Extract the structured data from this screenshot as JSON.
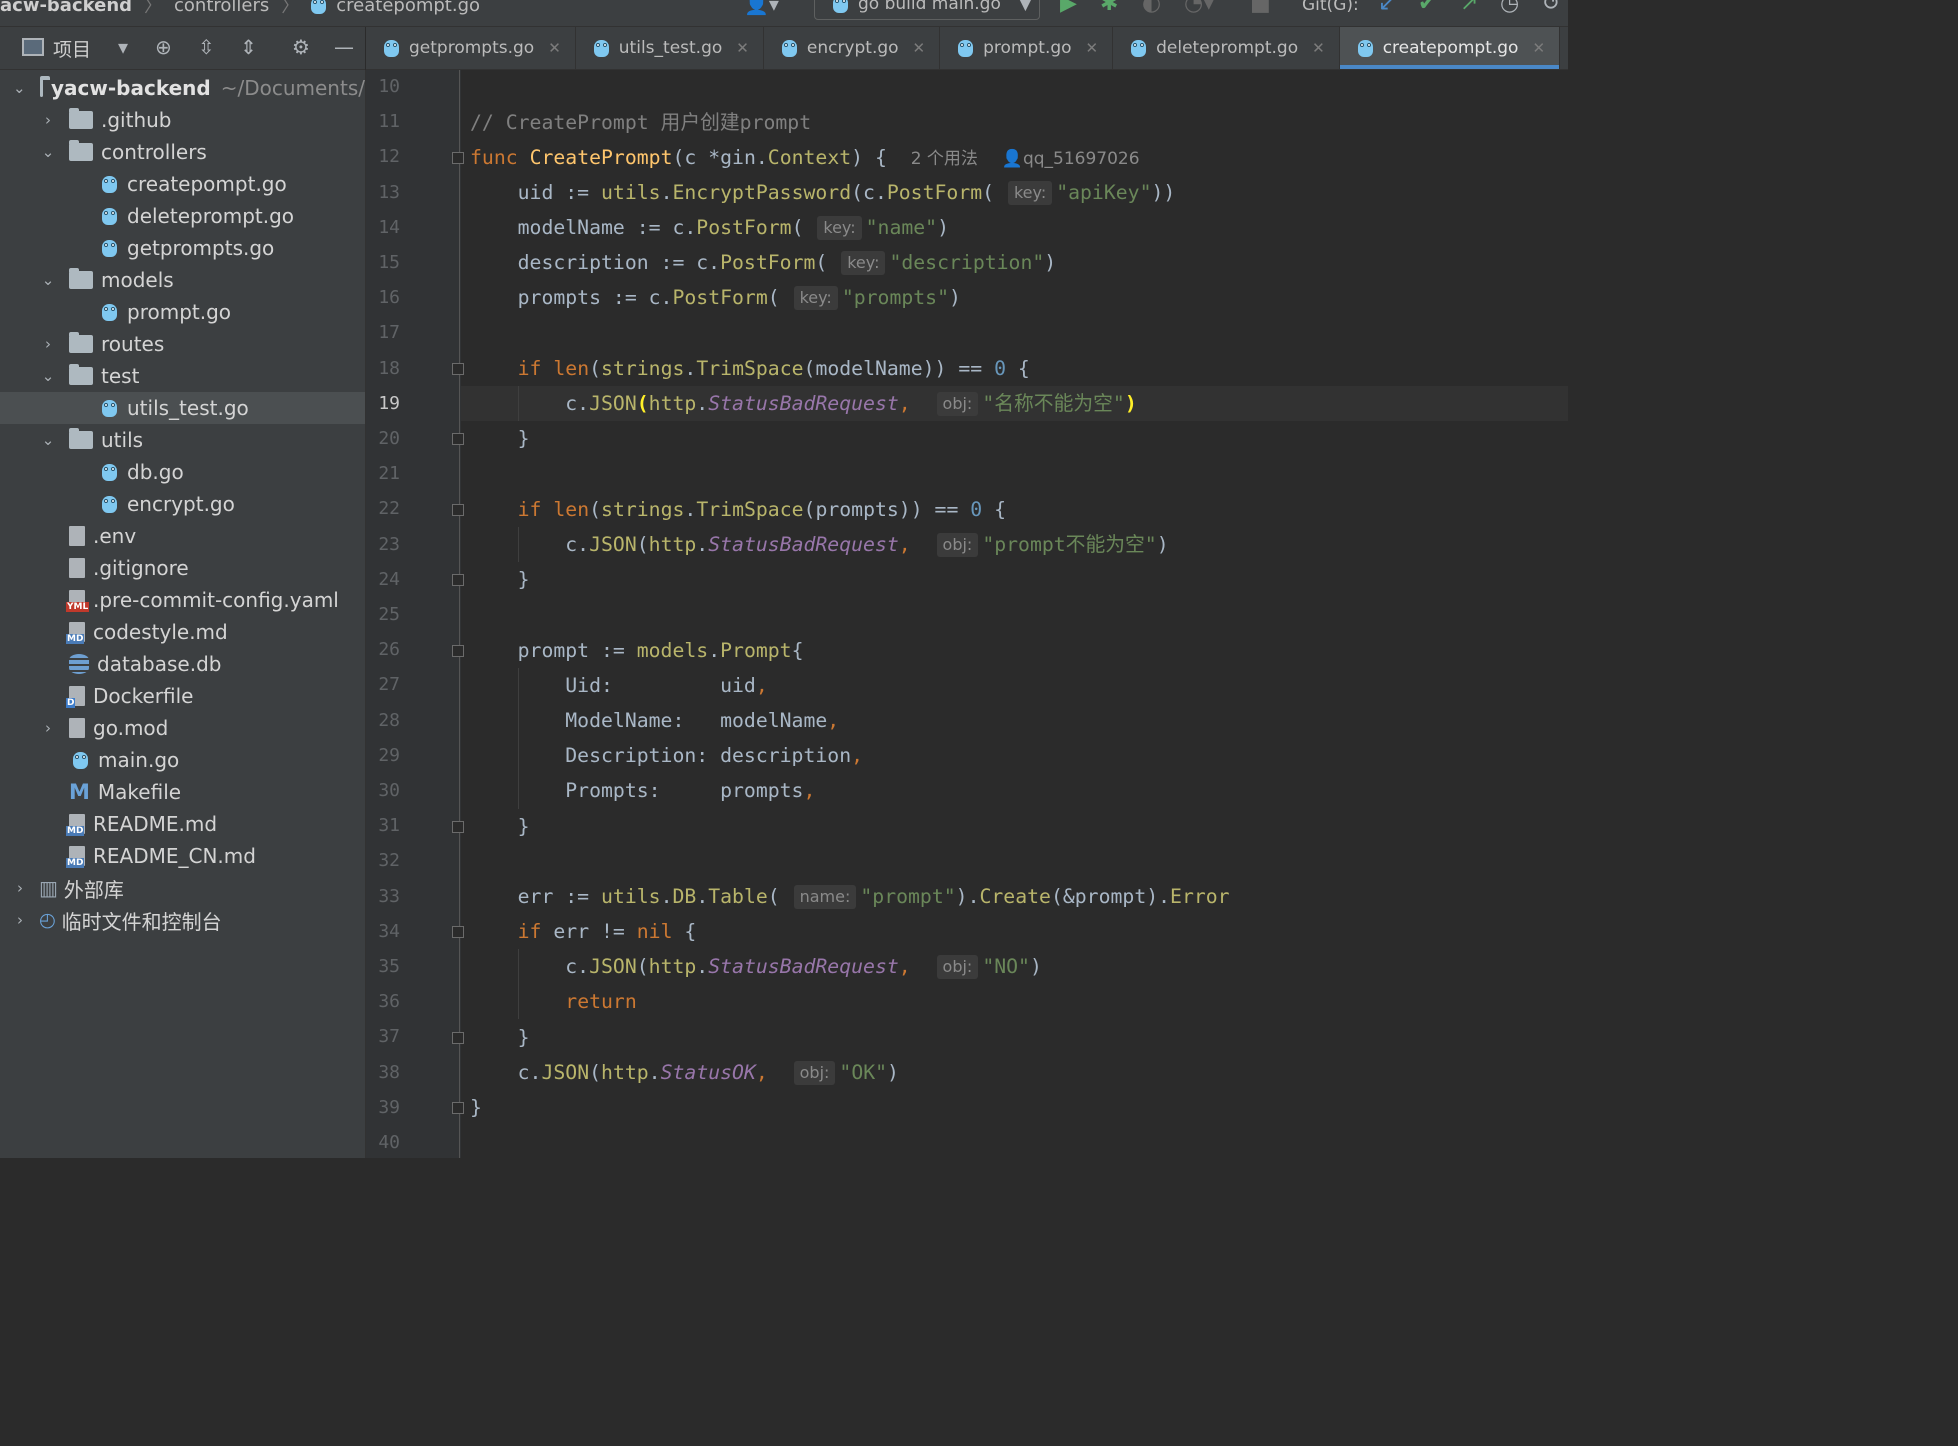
{
  "breadcrumb": {
    "project": "acw-backend",
    "folder": "controllers",
    "file": "createpompt.go"
  },
  "toolbar": {
    "run_config": "go build main.go",
    "git_label": "Git(G):"
  },
  "project_panel": {
    "title": "项目"
  },
  "tabs": [
    {
      "label": "getprompts.go",
      "active": false
    },
    {
      "label": "utils_test.go",
      "active": false
    },
    {
      "label": "encrypt.go",
      "active": false
    },
    {
      "label": "prompt.go",
      "active": false
    },
    {
      "label": "deleteprompt.go",
      "active": false
    },
    {
      "label": "createpompt.go",
      "active": true
    }
  ],
  "tree": {
    "root": {
      "label": "yacw-backend",
      "path": "~/Documents/"
    },
    "items": [
      {
        "label": ".github",
        "depth": 1,
        "kind": "folder",
        "open": false
      },
      {
        "label": "controllers",
        "depth": 1,
        "kind": "folder",
        "open": true
      },
      {
        "label": "createpompt.go",
        "depth": 2,
        "kind": "go"
      },
      {
        "label": "deleteprompt.go",
        "depth": 2,
        "kind": "go"
      },
      {
        "label": "getprompts.go",
        "depth": 2,
        "kind": "go"
      },
      {
        "label": "models",
        "depth": 1,
        "kind": "folder",
        "open": true
      },
      {
        "label": "prompt.go",
        "depth": 2,
        "kind": "go"
      },
      {
        "label": "routes",
        "depth": 1,
        "kind": "folder",
        "open": false
      },
      {
        "label": "test",
        "depth": 1,
        "kind": "folder",
        "open": true
      },
      {
        "label": "utils_test.go",
        "depth": 2,
        "kind": "go",
        "selected": true
      },
      {
        "label": "utils",
        "depth": 1,
        "kind": "folder",
        "open": true
      },
      {
        "label": "db.go",
        "depth": 2,
        "kind": "go"
      },
      {
        "label": "encrypt.go",
        "depth": 2,
        "kind": "go"
      },
      {
        "label": ".env",
        "depth": 1,
        "kind": "file"
      },
      {
        "label": ".gitignore",
        "depth": 1,
        "kind": "file"
      },
      {
        "label": ".pre-commit-config.yaml",
        "depth": 1,
        "kind": "yml"
      },
      {
        "label": "codestyle.md",
        "depth": 1,
        "kind": "md"
      },
      {
        "label": "database.db",
        "depth": 1,
        "kind": "db"
      },
      {
        "label": "Dockerfile",
        "depth": 1,
        "kind": "docker"
      },
      {
        "label": "go.mod",
        "depth": 1,
        "kind": "file",
        "collapsed": true
      },
      {
        "label": "main.go",
        "depth": 1,
        "kind": "go"
      },
      {
        "label": "Makefile",
        "depth": 1,
        "kind": "make"
      },
      {
        "label": "README.md",
        "depth": 1,
        "kind": "md"
      },
      {
        "label": "README_CN.md",
        "depth": 1,
        "kind": "md"
      }
    ],
    "external_libraries": "外部库",
    "scratches": "临时文件和控制台"
  },
  "editor": {
    "current_line": 19,
    "line_numbers": [
      "10",
      "11",
      "12",
      "13",
      "14",
      "15",
      "16",
      "17",
      "18",
      "19",
      "20",
      "21",
      "22",
      "23",
      "24",
      "25",
      "26",
      "27",
      "28",
      "29",
      "30",
      "31",
      "32",
      "33",
      "34",
      "35",
      "36",
      "37",
      "38",
      "39",
      "40"
    ],
    "usages": "2 个用法",
    "author": "qq_51697026",
    "hints": {
      "key": "key:",
      "obj": "obj:",
      "name": "name:"
    },
    "code": {
      "comment": "// CreatePrompt 用户创建prompt",
      "func_name": "CreatePrompt",
      "s_apikey": "\"apiKey\"",
      "s_name": "\"name\"",
      "s_description": "\"description\"",
      "s_prompts": "\"prompts\"",
      "s_name_empty": "\"名称不能为空\"",
      "s_prompt_empty": "\"prompt不能为空\"",
      "s_table": "\"prompt\"",
      "s_no": "\"NO\"",
      "s_ok": "\"OK\""
    }
  }
}
